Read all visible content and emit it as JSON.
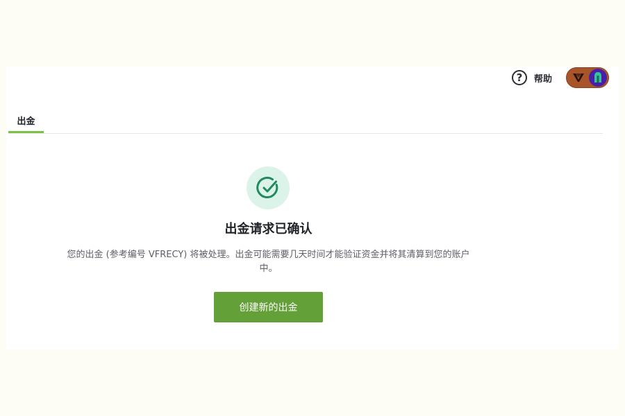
{
  "header": {
    "help_label": "帮助",
    "help_icon": "question-circle-icon",
    "brand_icon": "brand-logo-icon",
    "avatar_icon": "user-avatar-icon",
    "colors": {
      "account_switch_bg": "#a9552a",
      "avatar_bg": "#4a1fa8",
      "avatar_icon": "#37c0a0"
    }
  },
  "tabs": [
    {
      "label": "出金",
      "active": true
    }
  ],
  "confirmation": {
    "icon": "check-circle-icon",
    "title": "出金请求已确认",
    "description": "您的出金 (参考编号 VFRECY) 将被处理。出金可能需要几天时间才能验证资金并将其清算到您的账户中。",
    "button_label": "创建新的出金",
    "colors": {
      "accent": "#64a038",
      "tab_underline": "#7cc242",
      "success_bg": "#dcf3ea",
      "success_icon": "#1f8a5c"
    }
  }
}
